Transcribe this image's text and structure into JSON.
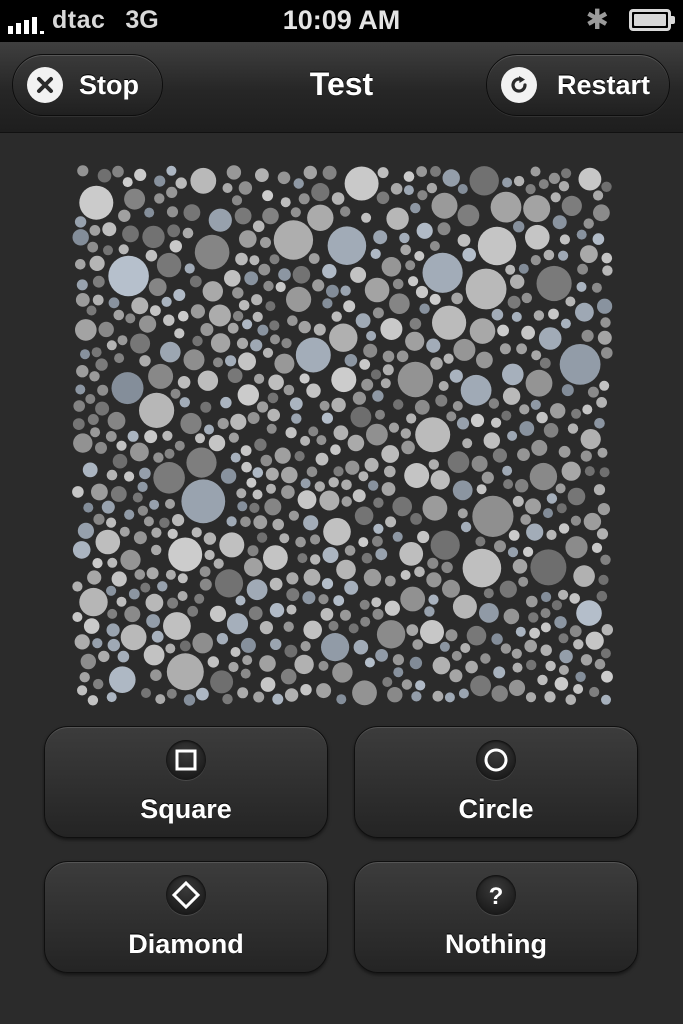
{
  "status_bar": {
    "carrier": "dtac",
    "network": "3G",
    "time": "10:09 AM"
  },
  "nav": {
    "title": "Test",
    "stop_label": "Stop",
    "restart_label": "Restart"
  },
  "answers": [
    {
      "label": "Square",
      "icon": "square-icon"
    },
    {
      "label": "Circle",
      "icon": "circle-icon"
    },
    {
      "label": "Diamond",
      "icon": "diamond-icon"
    },
    {
      "label": "Nothing",
      "icon": "question-icon"
    }
  ],
  "colors": {
    "background": "#2b2b2b",
    "dot_gray": "#8e8e8e",
    "dot_blue_gray": "#a8b4bf"
  }
}
